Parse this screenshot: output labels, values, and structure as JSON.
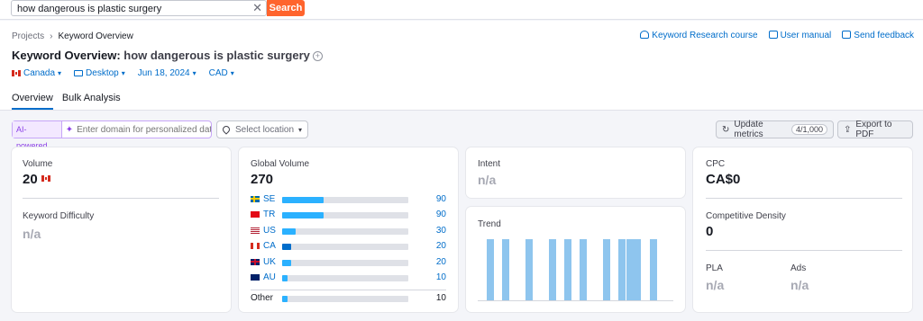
{
  "search": {
    "value": "how dangerous is plastic surgery",
    "button": "Search"
  },
  "breadcrumb": {
    "root": "Projects",
    "current": "Keyword Overview"
  },
  "help_links": [
    "Keyword Research course",
    "User manual",
    "Send feedback"
  ],
  "title": {
    "prefix": "Keyword Overview:",
    "keyword": "how dangerous is plastic surgery"
  },
  "filters": {
    "country": "Canada",
    "device": "Desktop",
    "date": "Jun 18, 2024",
    "currency": "CAD"
  },
  "tabs": [
    "Overview",
    "Bulk Analysis"
  ],
  "toolbar": {
    "ai_badge": "AI-powered",
    "domain_placeholder": "Enter domain for personalized data",
    "location_placeholder": "Select location",
    "update_label": "Update metrics",
    "update_counter": "4/1,000",
    "export_label": "Export to PDF"
  },
  "volume": {
    "label": "Volume",
    "value": "20"
  },
  "kd": {
    "label": "Keyword Difficulty",
    "value": "n/a"
  },
  "global_volume": {
    "label": "Global Volume",
    "value": "270",
    "rows": [
      {
        "code": "SE",
        "value": "90",
        "share": 0.33
      },
      {
        "code": "TR",
        "value": "90",
        "share": 0.33
      },
      {
        "code": "US",
        "value": "30",
        "share": 0.11
      },
      {
        "code": "CA",
        "value": "20",
        "share": 0.07
      },
      {
        "code": "UK",
        "value": "20",
        "share": 0.07
      },
      {
        "code": "AU",
        "value": "10",
        "share": 0.04
      }
    ],
    "other_label": "Other",
    "other_value": "10",
    "other_share": 0.04
  },
  "intent": {
    "label": "Intent",
    "value": "n/a"
  },
  "trend": {
    "label": "Trend",
    "bars": [
      1,
      0,
      1,
      0,
      0,
      1,
      0,
      0,
      1,
      0,
      1,
      0,
      1,
      0,
      0,
      1,
      0,
      1,
      1,
      1,
      0,
      1
    ]
  },
  "cpc": {
    "label": "CPC",
    "value": "CA$0"
  },
  "density": {
    "label": "Competitive Density",
    "value": "0"
  },
  "pla": {
    "label": "PLA",
    "value": "n/a"
  },
  "ads": {
    "label": "Ads",
    "value": "n/a"
  },
  "colors": {
    "accent": "#006dca",
    "search_btn": "#ff642d",
    "bar": "#2bb1ff",
    "trend_bar": "#8ec5ee"
  }
}
